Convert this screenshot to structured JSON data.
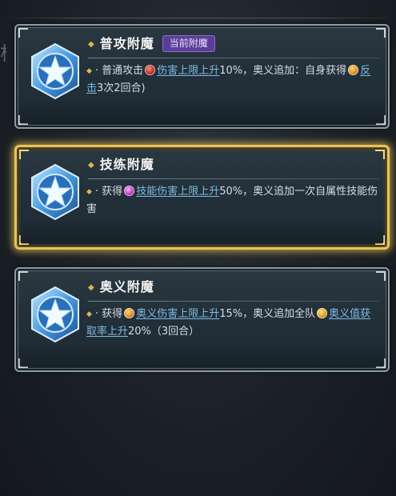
{
  "edge_glyph": "柯",
  "cards": [
    {
      "title": "普攻附魔",
      "badge": "当前附魔",
      "selected": false,
      "desc": {
        "p1": "· 普通攻击",
        "icon1": "attack-buff-icon",
        "kw1": "伤害上限上升",
        "p2": "10%，奥义追加：自身获得",
        "icon2": "counter-icon",
        "kw2": "反击",
        "p3": "3次2回合)"
      }
    },
    {
      "title": "技练附魔",
      "selected": true,
      "desc": {
        "p1": "· 获得",
        "icon1": "skill-buff-icon",
        "kw1": "技能伤害上限上升",
        "p2": "50%，奥义追加一次自属性技能伤害"
      }
    },
    {
      "title": "奥义附魔",
      "selected": false,
      "desc": {
        "p1": "· 获得",
        "icon1": "ougi-buff-icon",
        "kw1": "奥义伤害上限上升",
        "p2": "15%，奥义追加全队",
        "icon2": "charge-buff-icon",
        "kw2": "奥义值获取率上升",
        "p3": "20%（3回合）"
      }
    }
  ],
  "colors": {
    "selected_border": "#e8c35a",
    "keyword": "#7fb9e0",
    "badge_bg": "#5b3e97",
    "card_border": "#8d9aa2"
  }
}
